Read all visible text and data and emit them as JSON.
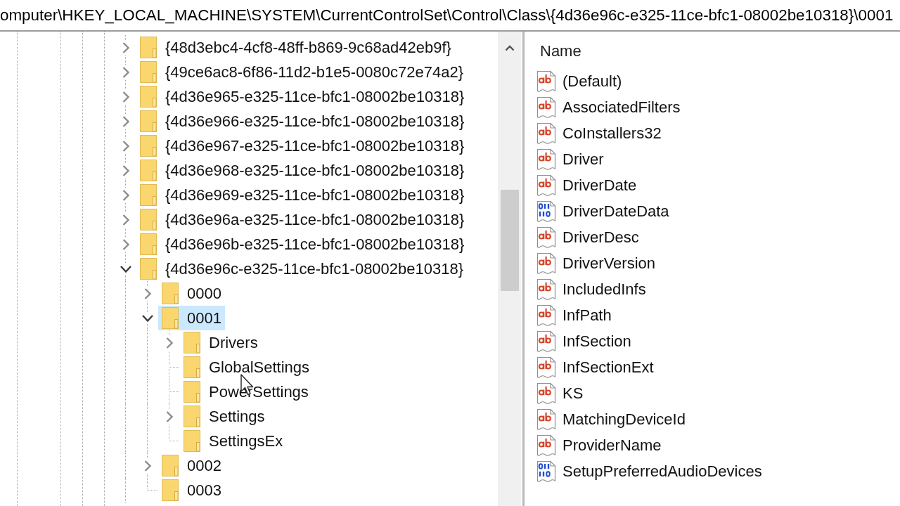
{
  "address_bar": {
    "path": "omputer\\HKEY_LOCAL_MACHINE\\SYSTEM\\CurrentControlSet\\Control\\Class\\{4d36e96c-e325-11ce-bfc1-08002be10318}\\0001"
  },
  "tree": {
    "items": [
      {
        "label": "{48d3ebc4-4cf8-48ff-b869-9c68ad42eb9f}",
        "has_subkeys": true,
        "expanded": false,
        "selected": false
      },
      {
        "label": "{49ce6ac8-6f86-11d2-b1e5-0080c72e74a2}",
        "has_subkeys": true,
        "expanded": false,
        "selected": false
      },
      {
        "label": "{4d36e965-e325-11ce-bfc1-08002be10318}",
        "has_subkeys": true,
        "expanded": false,
        "selected": false
      },
      {
        "label": "{4d36e966-e325-11ce-bfc1-08002be10318}",
        "has_subkeys": true,
        "expanded": false,
        "selected": false
      },
      {
        "label": "{4d36e967-e325-11ce-bfc1-08002be10318}",
        "has_subkeys": true,
        "expanded": false,
        "selected": false
      },
      {
        "label": "{4d36e968-e325-11ce-bfc1-08002be10318}",
        "has_subkeys": true,
        "expanded": false,
        "selected": false
      },
      {
        "label": "{4d36e969-e325-11ce-bfc1-08002be10318}",
        "has_subkeys": true,
        "expanded": false,
        "selected": false
      },
      {
        "label": "{4d36e96a-e325-11ce-bfc1-08002be10318}",
        "has_subkeys": true,
        "expanded": false,
        "selected": false
      },
      {
        "label": "{4d36e96b-e325-11ce-bfc1-08002be10318}",
        "has_subkeys": true,
        "expanded": false,
        "selected": false
      },
      {
        "label": "{4d36e96c-e325-11ce-bfc1-08002be10318}",
        "has_subkeys": true,
        "expanded": true,
        "selected": false,
        "children": [
          {
            "label": "0000",
            "has_subkeys": true,
            "expanded": false,
            "selected": false
          },
          {
            "label": "0001",
            "has_subkeys": true,
            "expanded": true,
            "selected": true,
            "children": [
              {
                "label": "Drivers",
                "has_subkeys": true,
                "expanded": false,
                "selected": false
              },
              {
                "label": "GlobalSettings",
                "has_subkeys": false,
                "expanded": false,
                "selected": false
              },
              {
                "label": "PowerSettings",
                "has_subkeys": false,
                "expanded": false,
                "selected": false
              },
              {
                "label": "Settings",
                "has_subkeys": true,
                "expanded": false,
                "selected": false
              },
              {
                "label": "SettingsEx",
                "has_subkeys": false,
                "expanded": false,
                "selected": false
              }
            ]
          },
          {
            "label": "0002",
            "has_subkeys": true,
            "expanded": false,
            "selected": false
          },
          {
            "label": "0003",
            "has_subkeys": false,
            "expanded": false,
            "selected": false
          }
        ]
      }
    ]
  },
  "values_pane": {
    "column_header": "Name",
    "values": [
      {
        "name": "(Default)",
        "kind": "string",
        "selected": false
      },
      {
        "name": "AssociatedFilters",
        "kind": "string",
        "selected": false
      },
      {
        "name": "CoInstallers32",
        "kind": "string",
        "selected": false
      },
      {
        "name": "Driver",
        "kind": "string",
        "selected": false
      },
      {
        "name": "DriverDate",
        "kind": "string",
        "selected": false
      },
      {
        "name": "DriverDateData",
        "kind": "binary",
        "selected": false
      },
      {
        "name": "DriverDesc",
        "kind": "string",
        "selected": false
      },
      {
        "name": "DriverVersion",
        "kind": "string",
        "selected": false
      },
      {
        "name": "IncludedInfs",
        "kind": "string",
        "selected": false
      },
      {
        "name": "InfPath",
        "kind": "string",
        "selected": false
      },
      {
        "name": "InfSection",
        "kind": "string",
        "selected": false
      },
      {
        "name": "InfSectionExt",
        "kind": "string",
        "selected": false
      },
      {
        "name": "KS",
        "kind": "string",
        "selected": false
      },
      {
        "name": "MatchingDeviceId",
        "kind": "string",
        "selected": false
      },
      {
        "name": "ProviderName",
        "kind": "string",
        "selected": false
      },
      {
        "name": "SetupPreferredAudioDevices",
        "kind": "binary",
        "selected": false
      }
    ]
  }
}
